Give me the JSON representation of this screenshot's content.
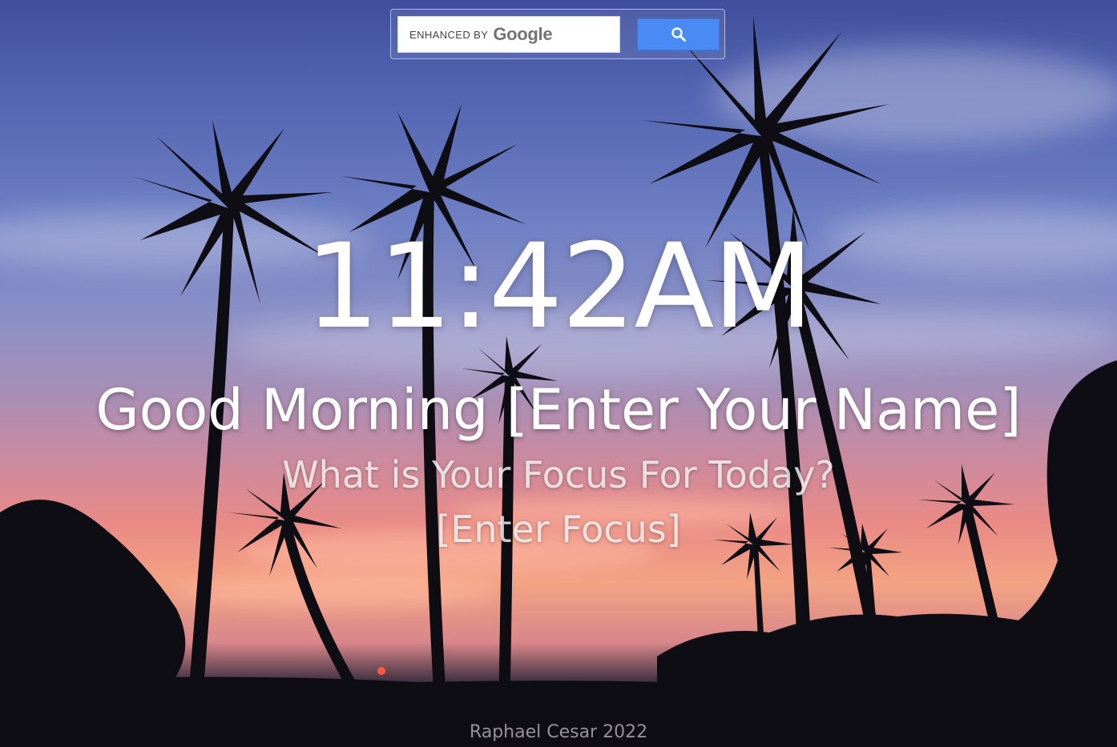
{
  "search": {
    "enhanced_label": "ENHANCED BY",
    "brand_label": "Google",
    "button_icon": "search-icon"
  },
  "clock": {
    "time": "11:42AM"
  },
  "greeting": {
    "text": "Good Morning [Enter Your Name]"
  },
  "focus": {
    "question": "What is Your Focus For Today?",
    "value": "[Enter Focus]"
  },
  "footer": {
    "credit": "Raphael Cesar 2022"
  },
  "colors": {
    "search_button": "#4a8af4",
    "text": "#ffffff"
  }
}
